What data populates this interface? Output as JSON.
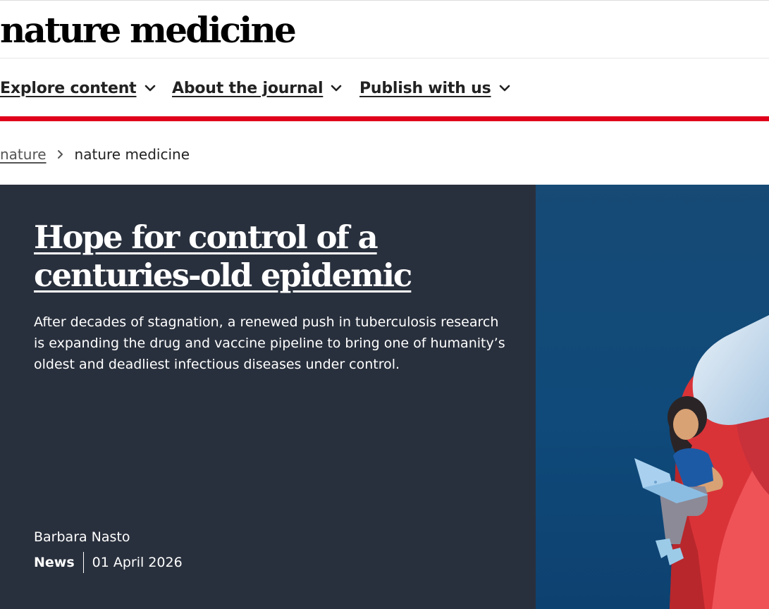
{
  "site": {
    "logo_text": "nature medicine"
  },
  "nav": {
    "items": [
      {
        "label": "Explore content"
      },
      {
        "label": "About the journal"
      },
      {
        "label": "Publish with us"
      }
    ]
  },
  "breadcrumb": {
    "parent": "nature",
    "current": "nature medicine"
  },
  "hero": {
    "title": "Hope for control of a centuries-old epidemic",
    "standfirst": "After decades of stagnation, a renewed push in tuberculosis research is expanding the drug and vaccine pipeline to bring one of humanity’s oldest and deadliest infectious diseases under control.",
    "author": "Barbara Nasto",
    "article_type": "News",
    "date": "01 April 2026"
  },
  "colors": {
    "accent_red": "#e0001b",
    "hero_dark": "#29303d",
    "hero_blue": "#0f4e7d"
  }
}
